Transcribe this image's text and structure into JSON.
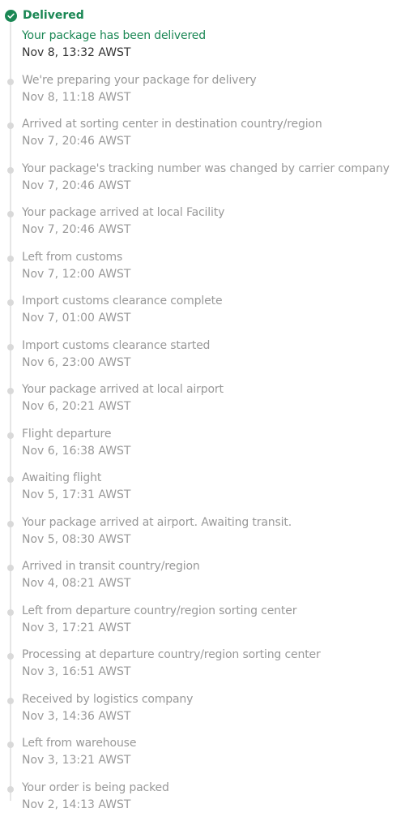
{
  "status": {
    "title": "Delivered",
    "accent_color": "#1a8754",
    "icon": "check-circle-icon"
  },
  "events": [
    {
      "description": "Your package has been delivered",
      "time": "Nov 8, 13:32 AWST",
      "current": true
    },
    {
      "description": "We're preparing your package for delivery",
      "time": "Nov 8, 11:18 AWST"
    },
    {
      "description": "Arrived at sorting center in destination country/region",
      "time": "Nov 7, 20:46 AWST"
    },
    {
      "description": "Your package's tracking number was changed by carrier company",
      "time": "Nov 7, 20:46 AWST"
    },
    {
      "description": "Your package arrived at local Facility",
      "time": "Nov 7, 20:46 AWST"
    },
    {
      "description": "Left from customs",
      "time": "Nov 7, 12:00 AWST"
    },
    {
      "description": "Import customs clearance complete",
      "time": "Nov 7, 01:00 AWST"
    },
    {
      "description": "Import customs clearance started",
      "time": "Nov 6, 23:00 AWST"
    },
    {
      "description": "Your package arrived at local airport",
      "time": "Nov 6, 20:21 AWST"
    },
    {
      "description": "Flight departure",
      "time": "Nov 6, 16:38 AWST"
    },
    {
      "description": "Awaiting flight",
      "time": "Nov 5, 17:31 AWST"
    },
    {
      "description": "Your package arrived at airport. Awaiting transit.",
      "time": "Nov 5, 08:30 AWST"
    },
    {
      "description": "Arrived in transit country/region",
      "time": "Nov 4, 08:21 AWST"
    },
    {
      "description": "Left from departure country/region sorting center",
      "time": "Nov 3, 17:21 AWST"
    },
    {
      "description": "Processing at departure country/region sorting center",
      "time": "Nov 3, 16:51 AWST"
    },
    {
      "description": "Received by logistics company",
      "time": "Nov 3, 14:36 AWST"
    },
    {
      "description": "Left from warehouse",
      "time": "Nov 3, 13:21 AWST"
    },
    {
      "description": "Your order is being packed",
      "time": "Nov 2, 14:13 AWST"
    }
  ]
}
